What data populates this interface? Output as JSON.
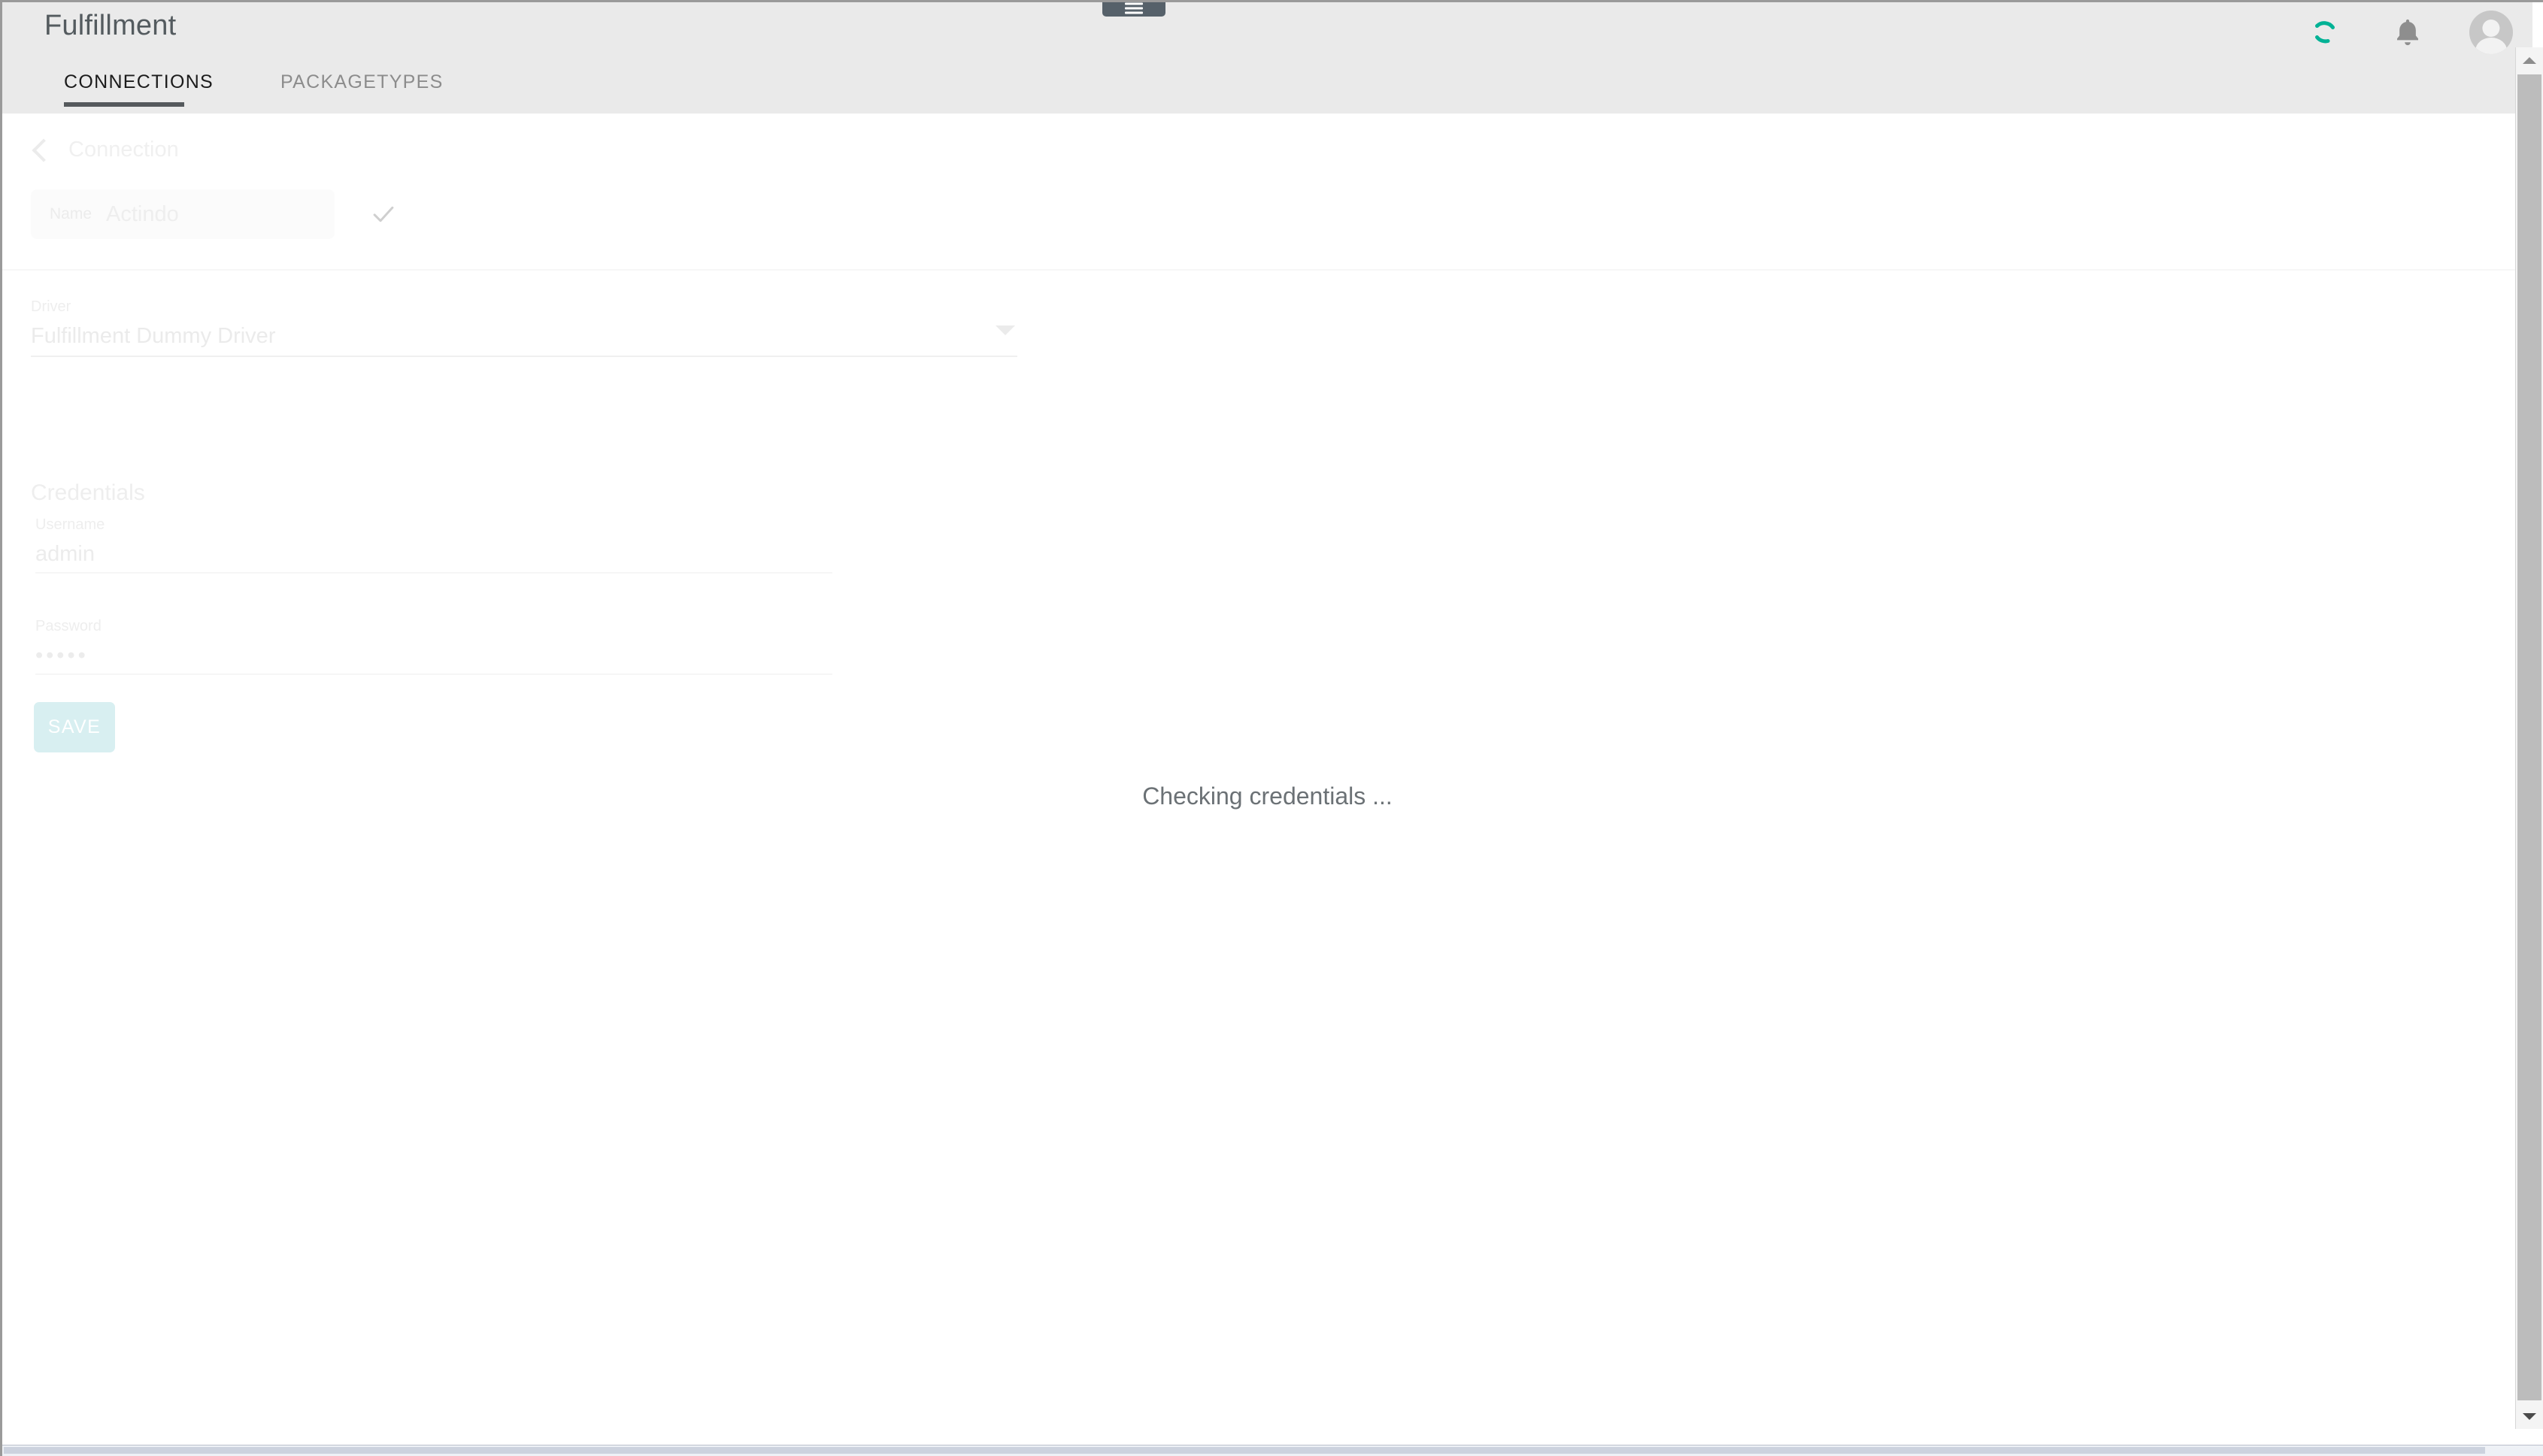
{
  "app": {
    "title": "Fulfillment"
  },
  "pulltab": {
    "icon": "hamburger-menu-icon"
  },
  "appbar_icons": {
    "spinner": {
      "name": "loading-spinner-icon",
      "color": "#00b295"
    },
    "notifications": {
      "name": "bell-icon",
      "color": "#8e8e8e"
    },
    "account": {
      "name": "user-avatar-icon"
    }
  },
  "tabs": [
    {
      "label": "CONNECTIONS",
      "active": true
    },
    {
      "label": "PACKAGETYPES",
      "active": false
    }
  ],
  "breadcrumb": {
    "back_icon": "chevron-left-icon",
    "label": "Connection"
  },
  "name_field": {
    "label": "Name",
    "value": "Actindo",
    "confirm_icon": "checkmark-icon"
  },
  "driver_field": {
    "label": "Driver",
    "value": "Fulfillment Dummy Driver",
    "caret_icon": "chevron-down-icon"
  },
  "credentials": {
    "title": "Credentials",
    "username": {
      "label": "Username",
      "value": "admin"
    },
    "password": {
      "label": "Password",
      "value": "•••••"
    }
  },
  "actions": {
    "save_label": "SAVE",
    "save_color": "#d8eff1"
  },
  "status": {
    "message": "Checking credentials ..."
  },
  "scrollbars": {
    "vertical": {
      "up_icon": "triangle-up-icon",
      "down_icon": "triangle-down-icon"
    }
  }
}
